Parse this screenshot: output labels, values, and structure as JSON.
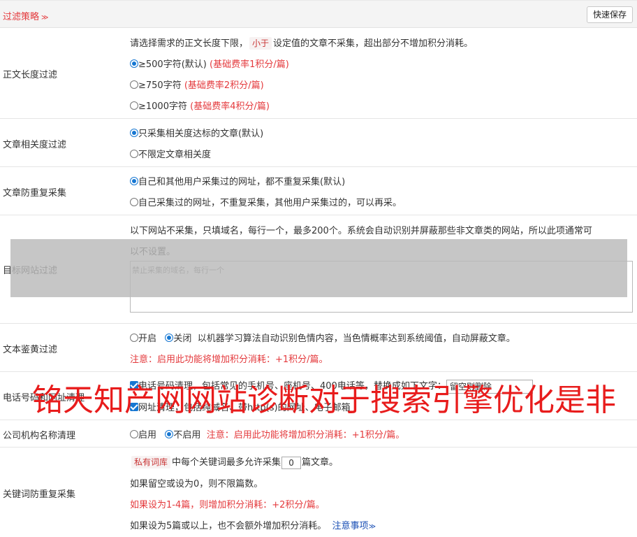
{
  "header": {
    "title": "过滤策略",
    "save_label": "快速保存"
  },
  "length_filter": {
    "label": "正文长度过滤",
    "desc_pre": "请选择需求的正文长度下限，",
    "desc_tag": "小于",
    "desc_post": "设定值的文章不采集，超出部分不增加积分消耗。",
    "options": [
      {
        "text": "≥500字符(默认)",
        "note": "(基础费率1积分/篇)",
        "checked": true
      },
      {
        "text": "≥750字符",
        "note": "(基础费率2积分/篇)",
        "checked": false
      },
      {
        "text": "≥1000字符",
        "note": "(基础费率4积分/篇)",
        "checked": false
      }
    ]
  },
  "relevance_filter": {
    "label": "文章相关度过滤",
    "options": [
      {
        "text": "只采集相关度达标的文章(默认)",
        "checked": true
      },
      {
        "text": "不限定文章相关度",
        "checked": false
      }
    ]
  },
  "dedupe": {
    "label": "文章防重复采集",
    "options": [
      {
        "text": "自己和其他用户采集过的网址，都不重复采集(默认)",
        "checked": true
      },
      {
        "text": "自己采集过的网址，不重复采集，其他用户采集过的，可以再采。",
        "checked": false
      }
    ]
  },
  "site_filter": {
    "label": "目标网站过滤",
    "desc_line1": "以下网站不采集，只填域名，每行一个，最多200个。系统会自动识别并屏蔽那些非文章类的网站，所以此项通常可",
    "desc_line2": "以不设置。",
    "placeholder": "禁止采集的域名，每行一个"
  },
  "porn_filter": {
    "label": "文本鉴黄过滤",
    "on_label": "开启",
    "off_label": "关闭",
    "desc": "以机器学习算法自动识别色情内容，当色情概率达到系统阈值，自动屏蔽文章。",
    "note": "注意：启用此功能将增加积分消耗：+1积分/篇。"
  },
  "phone_clean": {
    "label": "电话号码和网址清理",
    "line1_pre": "电话号码清理，包括常见的手机号、座机号、400电话等，替换成如下文字：",
    "replace_value": "留空则删除",
    "line2": "网址清理，包括纯域名、带http(s)的网址、电子邮箱"
  },
  "org_clean": {
    "label": "公司机构名称清理",
    "on_label": "启用",
    "off_label": "不启用",
    "note": "注意：启用此功能将增加积分消耗：+1积分/篇。"
  },
  "keyword_dedupe": {
    "label": "关键词防重复采集",
    "tag": "私有词库",
    "line1_pre": "中每个关键词最多允许采集",
    "max_value": "0",
    "line1_post": "篇文章。",
    "line2": "如果留空或设为0，则不限篇数。",
    "line3": "如果设为1-4篇，则增加积分消耗：+2积分/篇。",
    "line4": "如果设为5篇或以上，也不会额外增加积分消耗。",
    "notice_link": "注意事项"
  },
  "watermark": "铭天知产网网站诊断对于搜索引擎优化是非"
}
